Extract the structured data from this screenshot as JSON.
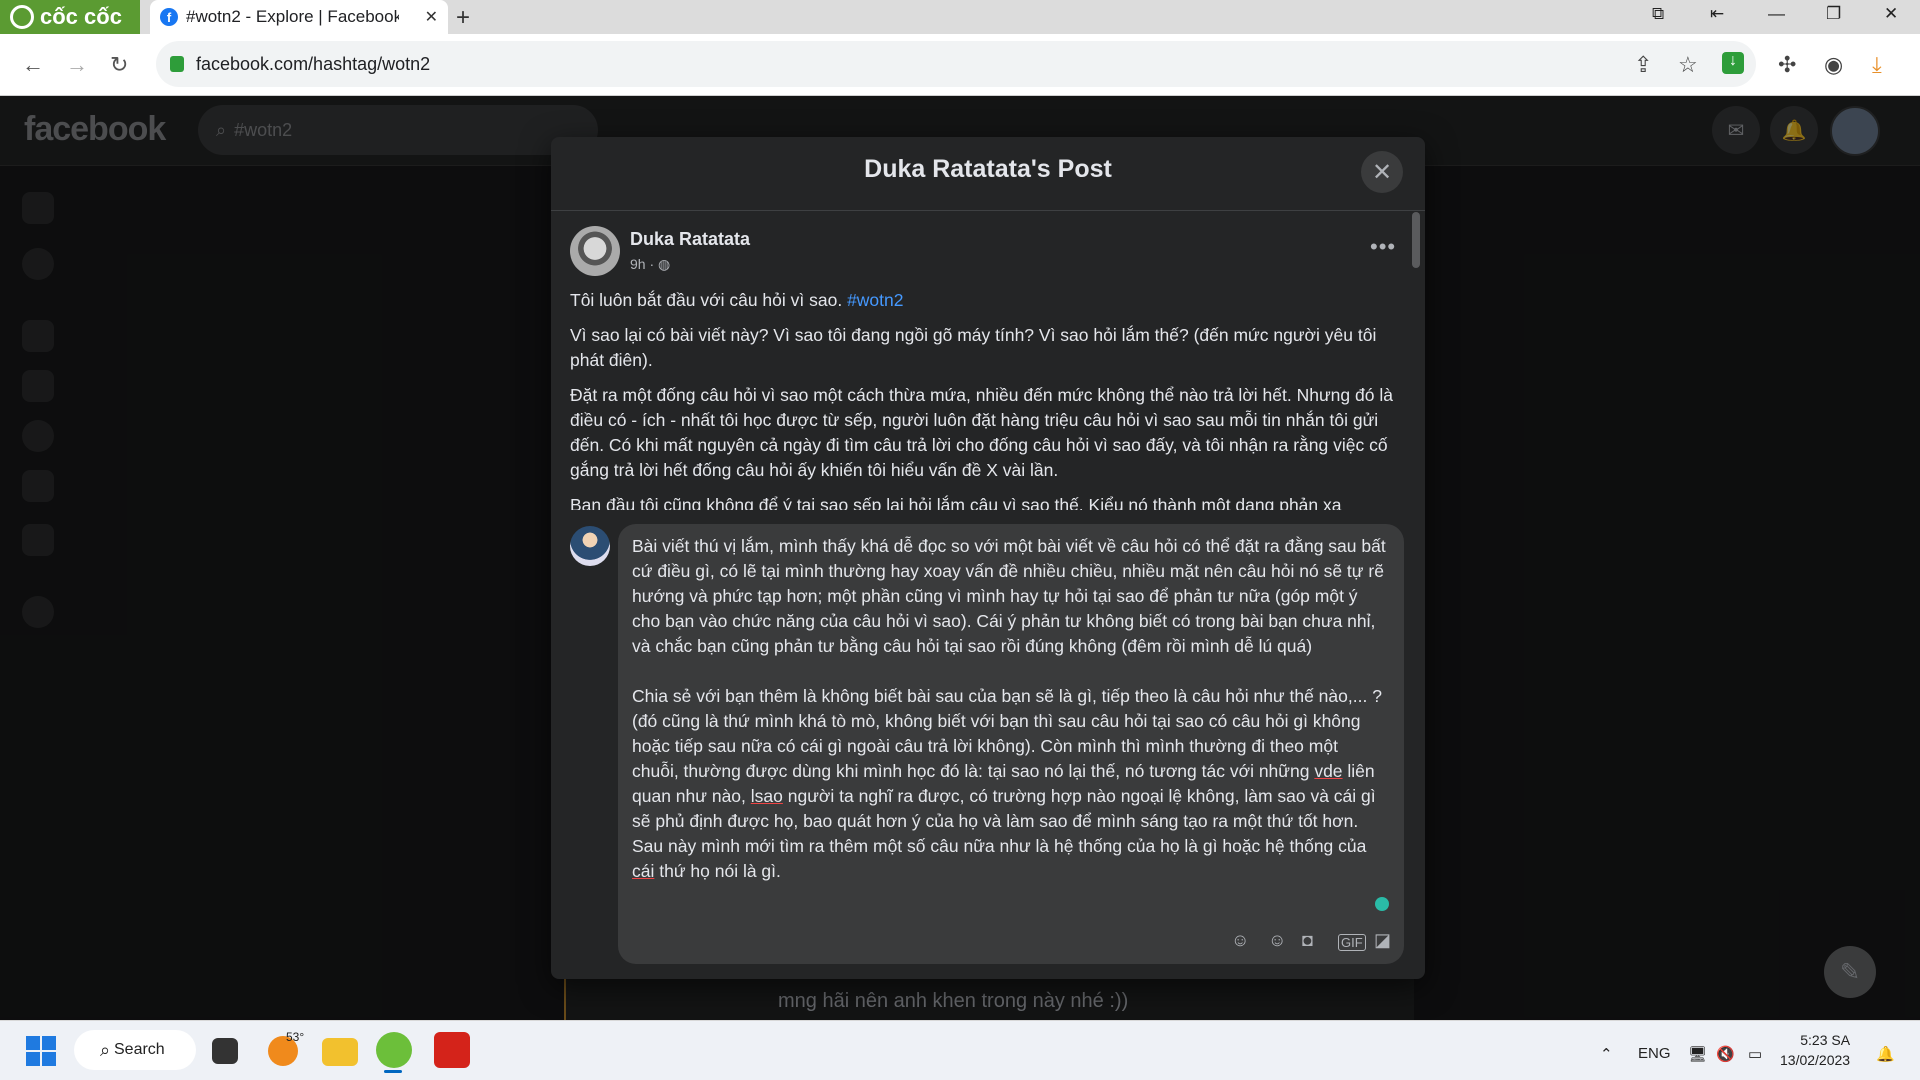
{
  "browser": {
    "brand": "cốc cốc",
    "tab_title": "#wotn2 - Explore | Facebook",
    "tab_close": "✕",
    "new_tab": "+",
    "url": "facebook.com/hashtag/wotn2"
  },
  "facebook": {
    "logo": "facebook",
    "search_value": "#wotn2",
    "behind_text": "mng hãi nên anh khen trong này nhé :))"
  },
  "modal": {
    "title": "Duka Ratatata's Post",
    "close": "✕",
    "post": {
      "author": "Duka Ratatata",
      "time": "9h · ",
      "more": "•••",
      "p1_text": "Tôi luôn bắt đầu với câu hỏi vì sao. ",
      "p1_hashtag": "#wotn2",
      "p2": "Vì sao lại có bài viết này? Vì sao tôi đang ngồi gõ máy tính? Vì sao hỏi lắm thế? (đến mức người yêu tôi phát điên).",
      "p3": "Đặt ra một đống câu hỏi vì sao một cách thừa mứa, nhiều đến mức không thể nào trả lời hết. Nhưng đó là điều có - ích - nhất tôi học được từ sếp, người luôn đặt hàng triệu câu hỏi vì sao sau mỗi tin nhắn tôi gửi đến. Có khi mất nguyên cả ngày đi tìm câu trả lời cho đống câu hỏi vì sao đấy, và tôi nhận ra rằng việc cố gắng trả lời hết đống câu hỏi ấy khiến tôi hiểu vấn đề X vài lần.",
      "p4": "Ban đầu tôi cũng không để ý tại sao sếp lại hỏi lắm câu vì sao thế. Kiểu nó thành một dạng phản xạ"
    },
    "comment": {
      "para1": "Bài viết thú vị lắm, mình thấy khá dễ đọc so với một bài viết về câu hỏi có thể đặt ra đằng sau bất cứ điều gì, có lẽ tại mình thường hay xoay vấn đề nhiều chiều, nhiều mặt nên câu hỏi nó sẽ tự rẽ hướng và phức tạp hơn; một phần cũng vì mình hay tự hỏi tại sao để phản tư nữa (góp một ý cho bạn vào chức năng của câu hỏi vì sao). Cái ý phản tư không biết có trong bài bạn chưa nhỉ, và chắc bạn cũng phản tư bằng câu hỏi tại sao rồi đúng không (đêm rồi mình dễ lú quá)",
      "para2_a": "Chia sẻ với bạn thêm là không biết bài sau của bạn sẽ là gì, tiếp theo là câu hỏi như thế nào,... ? (đó cũng là thứ mình khá tò mò, không biết với bạn thì sau câu hỏi tại sao có câu hỏi gì không hoặc tiếp sau nữa có cái gì ngoài câu trả lời không). Còn mình thì mình thường đi theo một chuỗi, thường được dùng khi mình học đó là: tại sao nó lại thế, nó tương tác với những ",
      "word_vde": "vde",
      "para2_b": " liên quan như nào, ",
      "word_lsao": "lsao",
      "para2_c": " người ta nghĩ ra được, có trường hợp nào ngoại lệ không, làm sao và cái gì sẽ phủ định được họ, bao quát hơn ý của họ và làm sao để mình sáng tạo ra một thứ tốt hơn. Sau này mình mới tìm ra thêm một số câu nữa như là hệ thống của họ là gì hoặc hệ thống của ",
      "word_cai": "cái",
      "para2_d": " thứ họ nói là gì."
    }
  },
  "taskbar": {
    "search_label": "Search",
    "weather": "53°",
    "lang": "ENG",
    "time": "5:23 SA",
    "date": "13/02/2023"
  }
}
